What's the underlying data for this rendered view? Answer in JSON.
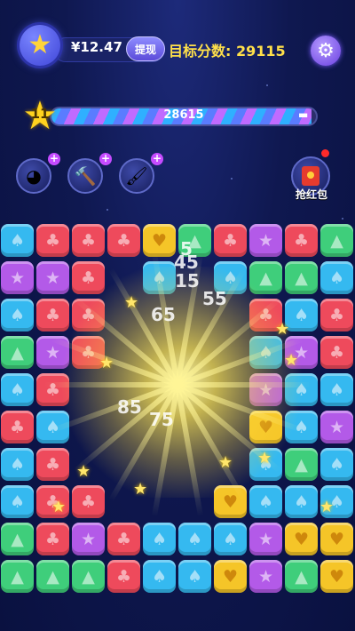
{
  "header": {
    "money": "¥12.47",
    "withdraw_label": "提现",
    "target_label": "目标分数: 29115"
  },
  "progress": {
    "level": "11",
    "score": "28615",
    "target": 29115,
    "fill_fraction": 0.983
  },
  "tools": [
    "color-wheel-icon",
    "hammer-icon",
    "brush-icon"
  ],
  "red_packet": {
    "label": "抢红包"
  },
  "score_popups": [
    "5",
    "45",
    "15",
    "55",
    "65",
    "85",
    "75"
  ],
  "colors": {
    "red": "#ee4a5c",
    "blue": "#35b9f0",
    "green": "#3fce7b",
    "purple": "#b35ae8",
    "yellow": "#f5c528"
  },
  "grid_rows": [
    [
      "blue",
      "red",
      "red",
      "red",
      "yellow",
      "green",
      "red",
      "purple",
      "red",
      "green"
    ],
    [
      "purple",
      "purple",
      "red",
      "",
      "blue",
      "",
      "blue",
      "green",
      "green",
      "blue"
    ],
    [
      "blue",
      "red",
      "red",
      "",
      "",
      "",
      "",
      "red",
      "blue",
      "red"
    ],
    [
      "green",
      "purple",
      "red",
      "",
      "",
      "",
      "",
      "blue",
      "purple",
      "red"
    ],
    [
      "blue",
      "red",
      "",
      "",
      "",
      "",
      "",
      "purple",
      "blue",
      "blue"
    ],
    [
      "red",
      "blue",
      "",
      "",
      "",
      "",
      "",
      "yellow",
      "blue",
      "purple"
    ],
    [
      "blue",
      "red",
      "",
      "",
      "",
      "",
      "",
      "blue",
      "green",
      "blue"
    ],
    [
      "blue",
      "red",
      "red",
      "",
      "",
      "",
      "yellow",
      "blue",
      "blue",
      "blue"
    ],
    [
      "green",
      "red",
      "purple",
      "red",
      "blue",
      "blue",
      "blue",
      "purple",
      "yellow",
      "yellow"
    ],
    [
      "green",
      "green",
      "green",
      "red",
      "blue",
      "blue",
      "yellow",
      "purple",
      "green",
      "yellow"
    ]
  ]
}
